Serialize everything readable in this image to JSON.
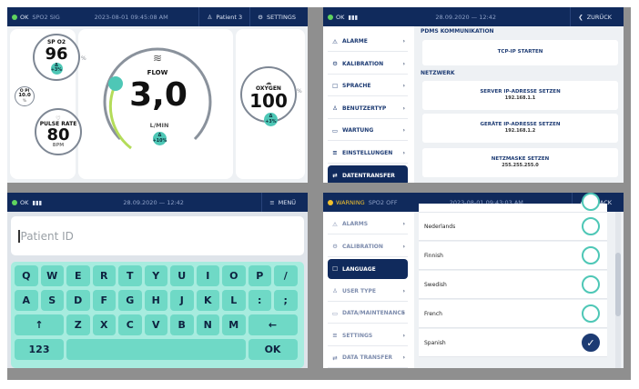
{
  "p1": {
    "status": "OK",
    "spo2_icon_label": "SPO2 SIG",
    "datetime": "2023-08-01 09:45:08 AM",
    "patient": "Patient 3",
    "settings": "SETTINGS",
    "spo2_label": "SP O2",
    "spo2_value": "96",
    "spo2_unit": "%",
    "spo2_badge": "+3%",
    "pi_label": "O PI",
    "pi_value": "10.0",
    "pi_unit": "%",
    "pr_label": "PULSE RATE",
    "pr_value": "80",
    "pr_unit": "BPM",
    "flow_label": "FLOW",
    "flow_value": "3,0",
    "flow_unit": "L/MIN",
    "flow_badge": "+10%",
    "oxy_label": "OXYGEN",
    "oxy_value": "100",
    "oxy_unit": "%",
    "oxy_badge": "+3%"
  },
  "p2": {
    "status": "OK",
    "datetime": "28.09.2020 — 12:42",
    "back": "ZURÜCK",
    "menu": [
      {
        "icon": "bell-icon",
        "glyph": "⚠",
        "label": "ALARME"
      },
      {
        "icon": "calibration-icon",
        "glyph": "⚙",
        "label": "KALIBRATION"
      },
      {
        "icon": "chat-icon",
        "glyph": "☐",
        "label": "SPRACHE"
      },
      {
        "icon": "user-icon",
        "glyph": "♙",
        "label": "BENUTZERTYP"
      },
      {
        "icon": "monitor-icon",
        "glyph": "▭",
        "label": "WARTUNG"
      },
      {
        "icon": "sliders-icon",
        "glyph": "≡",
        "label": "EINSTELLUNGEN"
      },
      {
        "icon": "transfer-icon",
        "glyph": "⇄",
        "label": "DATENTRANSFER"
      }
    ],
    "section1": "PDMS KOMMUNIKATION",
    "tcp_button": "TCP-IP STARTEN",
    "section2": "NETZWERK",
    "ip_button": "SERVER IP-ADRESSE SETZEN",
    "ip_value": "192.168.1.1",
    "dev_button": "GERÄTE IP-ADRESSE SETZEN",
    "dev_value": "192.168.1.2",
    "mask_button": "NETZMASKE SETZEN",
    "mask_value": "255.255.255.0"
  },
  "p3": {
    "status": "OK",
    "datetime": "28.09.2020 — 12:42",
    "menu_label": "MENÜ",
    "placeholder": "Patient ID",
    "row1": [
      "Q",
      "W",
      "E",
      "R",
      "T",
      "Y",
      "U",
      "I",
      "O",
      "P",
      "/"
    ],
    "row2": [
      "A",
      "S",
      "D",
      "F",
      "G",
      "H",
      "J",
      "K",
      "L",
      ":",
      ";"
    ],
    "row3": [
      "↑",
      "Z",
      "X",
      "C",
      "V",
      "B",
      "N",
      "M",
      "←"
    ],
    "mode_key": "123",
    "ok_key": "OK"
  },
  "p4": {
    "status": "WARNING",
    "spo2_off": "SPO2 OFF",
    "datetime": "2023-08-01 09:43:03 AM",
    "back": "BACK",
    "menu": [
      {
        "icon": "bell-icon",
        "glyph": "⚠",
        "label": "ALARMS"
      },
      {
        "icon": "calibration-icon",
        "glyph": "⚙",
        "label": "CALIBRATION"
      },
      {
        "icon": "chat-icon",
        "glyph": "☐",
        "label": "LANGUAGE"
      },
      {
        "icon": "user-icon",
        "glyph": "♙",
        "label": "USER TYPE"
      },
      {
        "icon": "monitor-icon",
        "glyph": "▭",
        "label": "DATA/MAINTENANCE"
      },
      {
        "icon": "sliders-icon",
        "glyph": "≡",
        "label": "SETTINGS"
      },
      {
        "icon": "transfer-icon",
        "glyph": "⇄",
        "label": "DATA TRANSFER"
      }
    ],
    "languages": [
      "Nederlands",
      "Finnish",
      "Swedish",
      "French",
      "Spanish"
    ],
    "selected": "Spanish"
  },
  "colors": {
    "navy": "#102a5c",
    "teal": "#4ec7b6",
    "key": "#6fd9c6",
    "keyboard": "#a7ecdf"
  }
}
